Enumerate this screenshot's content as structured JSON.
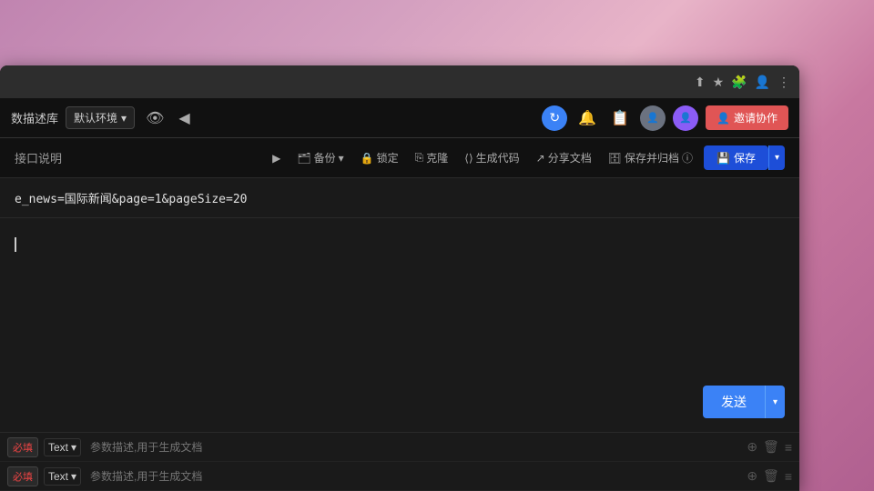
{
  "browser": {
    "topbar_icons": [
      "share-icon",
      "bookmark-icon",
      "puzzle-icon",
      "profile-icon",
      "more-icon"
    ]
  },
  "navbar": {
    "db_label": "数描述库",
    "env_label": "默认环境",
    "invite_label": "邀请协作"
  },
  "toolbar": {
    "api_desc_label": "接口说明",
    "backup_label": "备份",
    "lock_label": "锁定",
    "clone_label": "克隆",
    "generate_code_label": "生成代码",
    "share_doc_label": "分享文档",
    "save_archive_label": "保存并归档",
    "save_label": "保存"
  },
  "url_bar": {
    "url_text": "e_news=国际新闻&page=1&pageSize=20"
  },
  "send_button": {
    "label": "发送"
  },
  "params": [
    {
      "required": "必填",
      "type": "Text",
      "placeholder": "参数描述,用于生成文档"
    },
    {
      "required": "必填",
      "type": "Text",
      "placeholder": "参数描述,用于生成文档"
    }
  ],
  "cursor": {
    "symbol": "▶"
  }
}
